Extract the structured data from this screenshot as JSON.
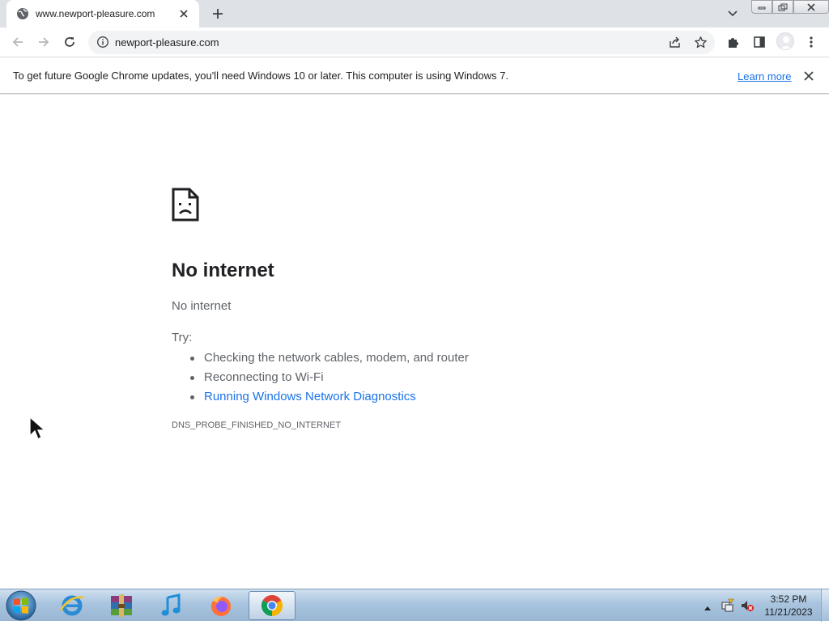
{
  "browser": {
    "tab_title": "www.newport-pleasure.com",
    "url": "newport-pleasure.com"
  },
  "infobar": {
    "message": "To get future Google Chrome updates, you'll need Windows 10 or later. This computer is using Windows 7.",
    "learn_more": "Learn more"
  },
  "error_page": {
    "title": "No internet",
    "subtitle": "No internet",
    "try_label": "Try:",
    "suggestions": [
      "Checking the network cables, modem, and router",
      "Reconnecting to Wi-Fi",
      "Running Windows Network Diagnostics"
    ],
    "error_code": "DNS_PROBE_FINISHED_NO_INTERNET"
  },
  "taskbar": {
    "apps": [
      "internet-explorer",
      "archive-manager",
      "itunes",
      "firefox",
      "chrome"
    ],
    "active_app": "chrome",
    "clock_time": "3:52 PM",
    "clock_date": "11/21/2023"
  },
  "colors": {
    "link_blue": "#1a73e8",
    "tabstrip_gray": "#dee1e6",
    "text_dark": "#202124",
    "text_gray": "#5f6368"
  }
}
